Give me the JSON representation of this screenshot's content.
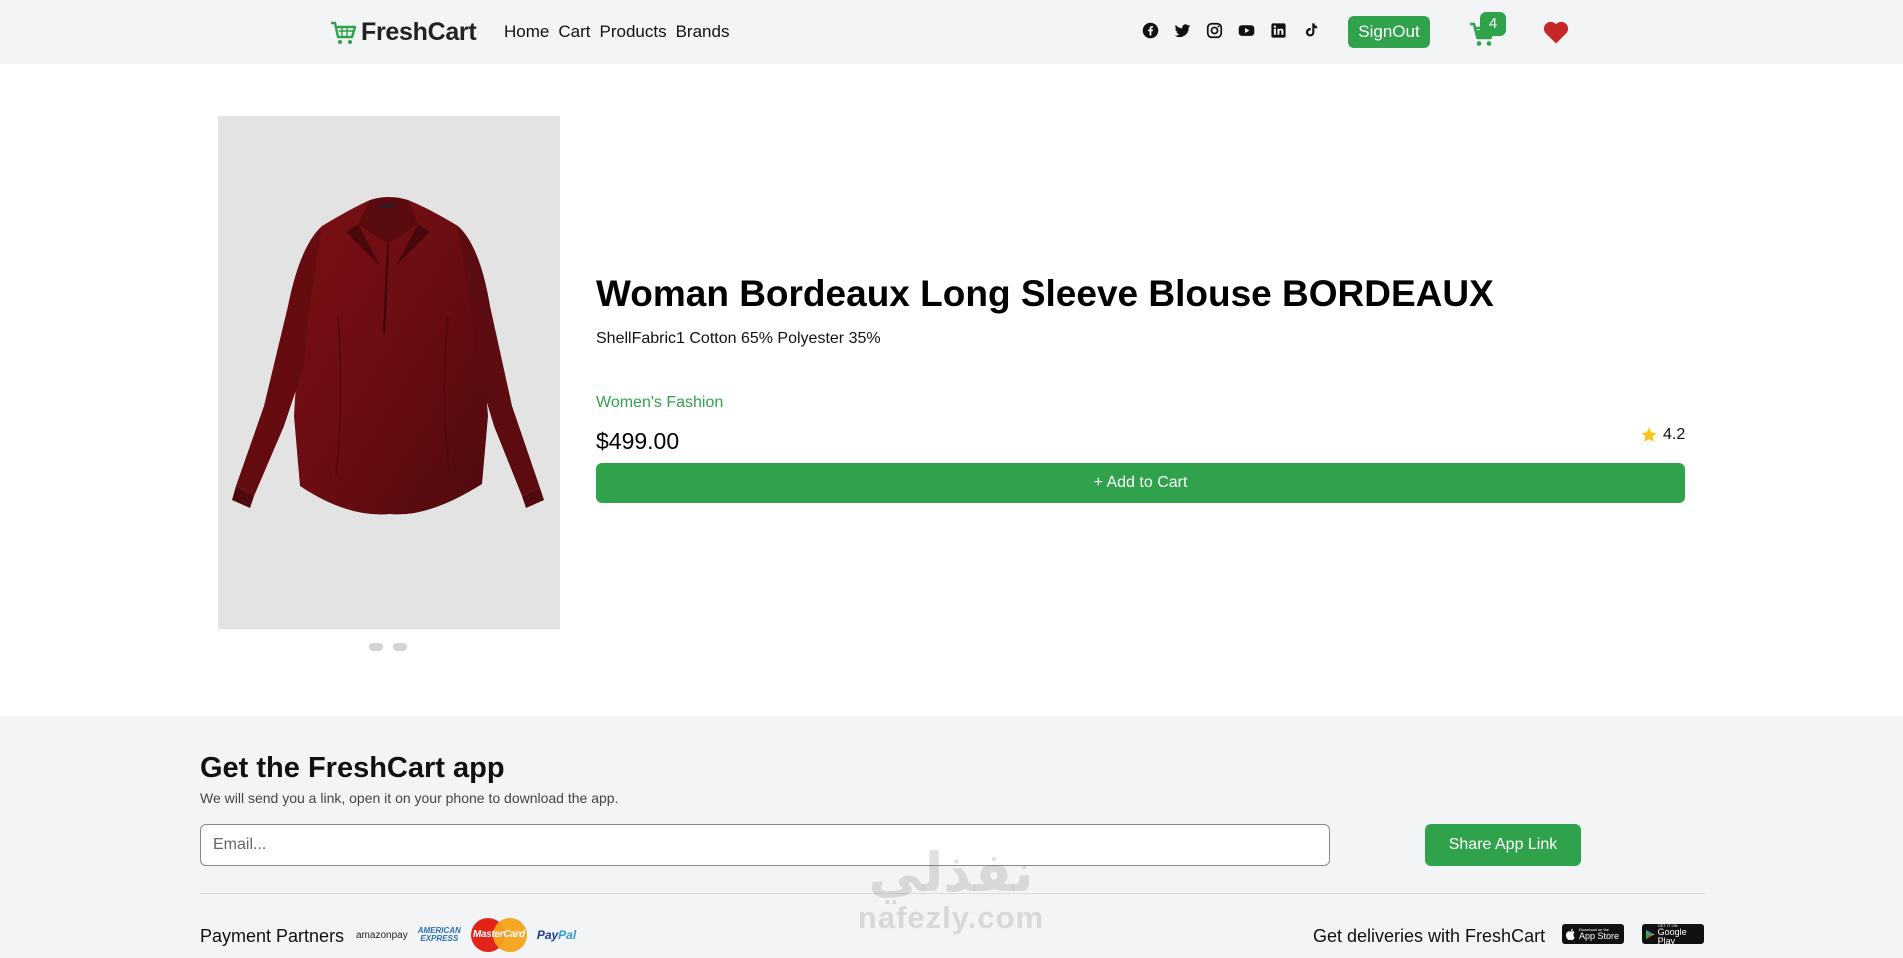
{
  "header": {
    "brand": "FreshCart",
    "nav": [
      "Home",
      "Cart",
      "Products",
      "Brands"
    ],
    "socials": [
      "facebook-icon",
      "twitter-icon",
      "instagram-icon",
      "youtube-icon",
      "linkedin-icon",
      "tiktok-icon"
    ],
    "signout_label": "SignOut",
    "cart_count": "4"
  },
  "product": {
    "title": "Woman Bordeaux Long Sleeve Blouse BORDEAUX",
    "description": "ShellFabric1 Cotton 65% Polyester 35%",
    "category": "Women's Fashion",
    "price": "$499.00",
    "rating": "4.2",
    "add_to_cart_label": "+ Add to Cart",
    "image_dots": 2
  },
  "footer": {
    "title": "Get the FreshCart app",
    "subtitle": "We will send you a link, open it on your phone to download the app.",
    "email_placeholder": "Email...",
    "share_label": "Share App Link",
    "payment_label": "Payment Partners",
    "payment_logos": {
      "amazon": "amazon",
      "amazon_suffix": "pay",
      "amex_line1": "AMERICAN",
      "amex_line2": "EXPRESS",
      "mastercard": "MasterCard",
      "paypal_a": "Pay",
      "paypal_b": "Pal"
    },
    "delivery_label": "Get deliveries with FreshCart",
    "appstore_small": "Download on the",
    "appstore_big": "App Store",
    "googleplay_small": "GET IT ON",
    "googleplay_big": "Google Play"
  },
  "watermark": {
    "arabic": "نفذلي",
    "latin": "nafezly.com"
  },
  "colors": {
    "accent": "#31a24c",
    "heart": "#c62828",
    "star": "#f5c518",
    "navbar_bg": "#f3f4f6"
  }
}
